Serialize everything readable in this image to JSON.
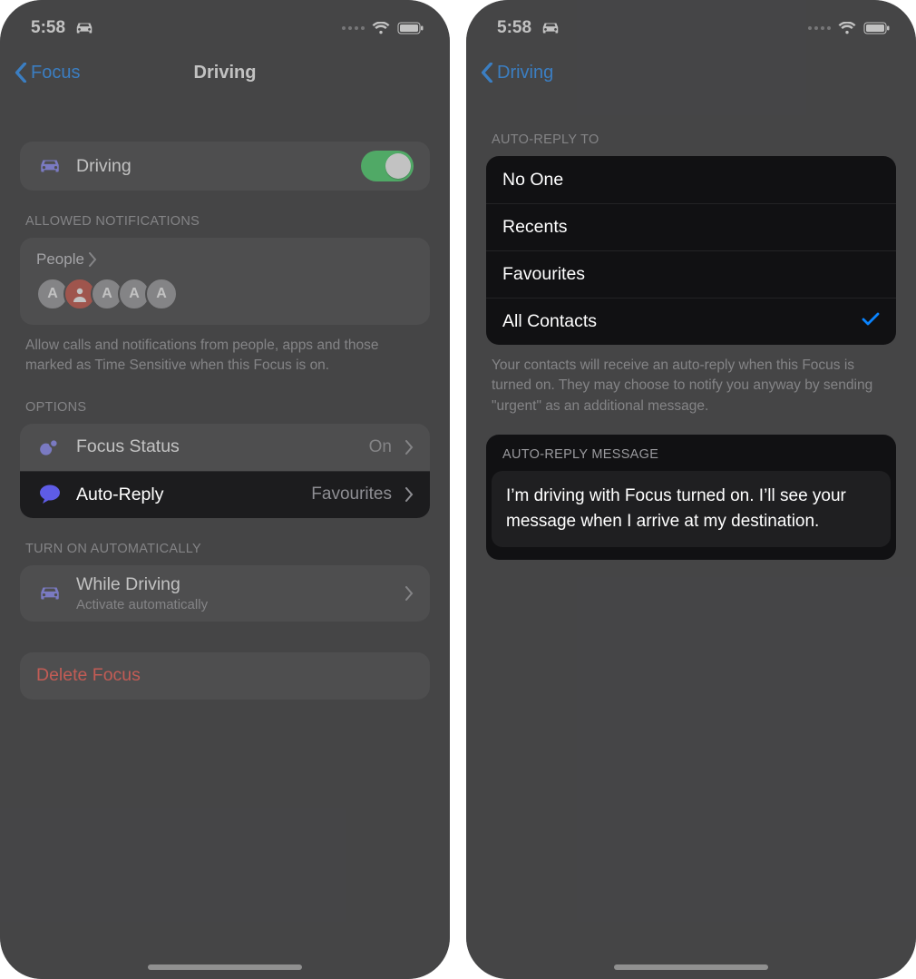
{
  "left": {
    "status": {
      "time": "5:58"
    },
    "nav": {
      "back": "Focus",
      "title": "Driving"
    },
    "driving_toggle": {
      "label": "Driving"
    },
    "sections": {
      "allowed": {
        "header": "ALLOWED NOTIFICATIONS",
        "people_label": "People",
        "avatars": [
          "A",
          "",
          "A",
          "A",
          "A"
        ],
        "footer": "Allow calls and notifications from people, apps and those marked as Time Sensitive when this Focus is on."
      },
      "options": {
        "header": "OPTIONS",
        "rows": [
          {
            "label": "Focus Status",
            "detail": "On"
          },
          {
            "label": "Auto-Reply",
            "detail": "Favourites"
          }
        ]
      },
      "auto": {
        "header": "TURN ON AUTOMATICALLY",
        "row": {
          "label": "While Driving",
          "sub": "Activate automatically"
        }
      },
      "delete": {
        "label": "Delete Focus"
      }
    }
  },
  "right": {
    "status": {
      "time": "5:58"
    },
    "nav": {
      "back": "Driving"
    },
    "reply_to": {
      "header": "AUTO-REPLY TO",
      "options": [
        "No One",
        "Recents",
        "Favourites",
        "All Contacts"
      ],
      "selected_index": 3,
      "footer": "Your contacts will receive an auto-reply when this Focus is turned on. They may choose to notify you anyway by sending \"urgent\" as an additional message."
    },
    "reply_msg": {
      "header": "AUTO-REPLY MESSAGE",
      "body": "I’m driving with Focus turned on. I’ll see your message when I arrive at my destination."
    }
  }
}
